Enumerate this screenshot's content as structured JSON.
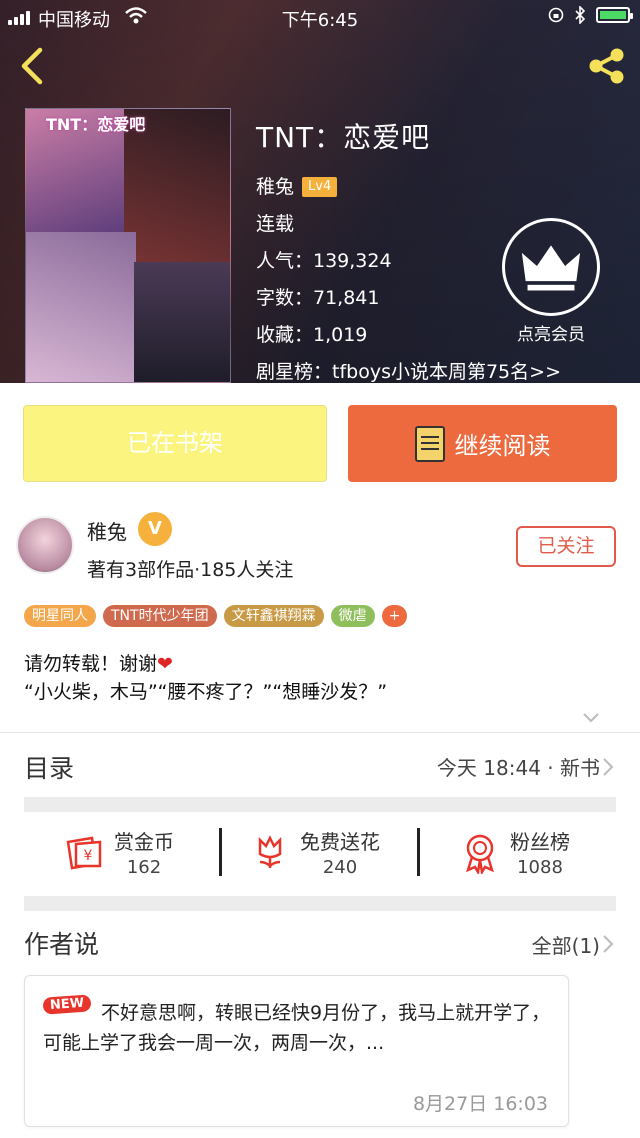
{
  "status_bar": {
    "carrier": "中国移动",
    "time": "下午6:45"
  },
  "book": {
    "title": "TNT：恋爱吧",
    "cover_text": "TNT：恋爱吧",
    "author": "稚兔",
    "level": "Lv4",
    "status": "连载",
    "popularity": "人气：139,324",
    "word_count": "字数：71,841",
    "favorites": "收藏：1,019",
    "ranking": "剧星榜：tfboys小说本周第75名>>"
  },
  "vip": {
    "label": "点亮会员"
  },
  "actions": {
    "shelf_label": "已在书架",
    "read_label": "继续阅读"
  },
  "author_row": {
    "name": "稚兔",
    "verified_badge": "V",
    "meta": "著有3部作品·185人关注",
    "follow_label": "已关注"
  },
  "tags": [
    {
      "label": "明星同人",
      "color": "#f3a64a"
    },
    {
      "label": "TNT时代少年团",
      "color": "#d06a4e"
    },
    {
      "label": "文轩鑫祺翔霖",
      "color": "#c99a46"
    },
    {
      "label": "微虐",
      "color": "#8fbf5a"
    },
    {
      "label": "+",
      "color": "#ec6a3d"
    }
  ],
  "description": {
    "line1": "请勿转载！谢谢",
    "line2": "“小火柴，木马”“腰不疼了？”“想睡沙发？”"
  },
  "toc": {
    "label": "目录",
    "info": "今天 18:44 · 新书"
  },
  "stats": [
    {
      "label": "赏金币",
      "count": "162",
      "icon": "reward-coin-icon"
    },
    {
      "label": "免费送花",
      "count": "240",
      "icon": "flower-icon"
    },
    {
      "label": "粉丝榜",
      "count": "1088",
      "icon": "medal-icon"
    }
  ],
  "author_says": {
    "label": "作者说",
    "all_label": "全部(1)",
    "new_badge": "NEW",
    "text": "不好意思啊，转眼已经快9月份了，我马上就开学了，可能上学了我会一周一次，两周一次，...",
    "time": "8月27日  16:03"
  },
  "colors": {
    "accent": "#ec6a3d",
    "shelf_button": "#fbf580",
    "follow": "#e25a4a",
    "badge_gold": "#f5b13b"
  }
}
